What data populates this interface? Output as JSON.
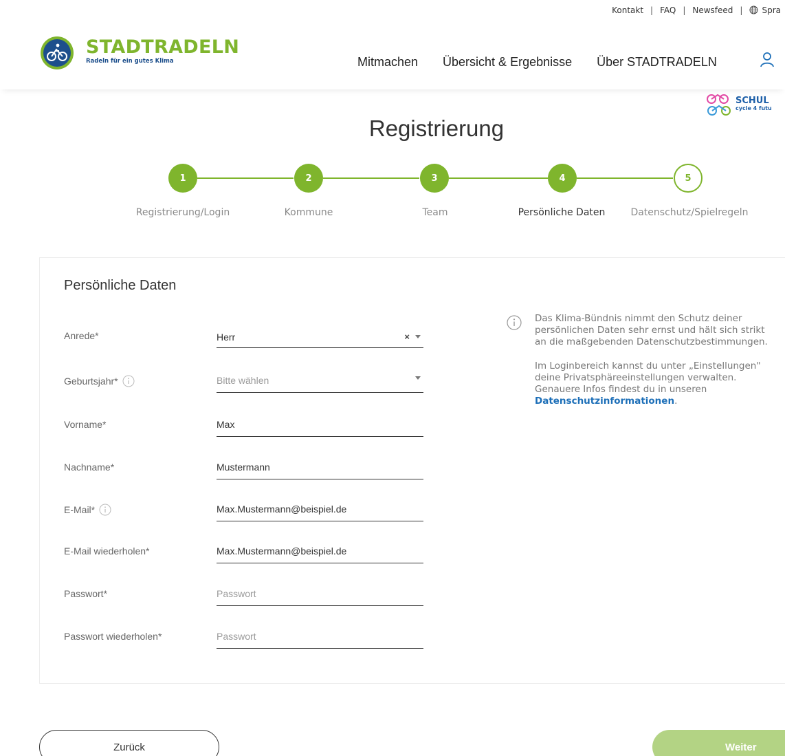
{
  "topbar": {
    "links": [
      "Kontakt",
      "FAQ",
      "Newsfeed"
    ],
    "language_label": "Spra"
  },
  "brand": {
    "name": "STADTRADELN",
    "tagline": "Radeln für ein gutes Klima"
  },
  "nav": {
    "items": [
      "Mitmachen",
      "Übersicht & Ergebnisse",
      "Über STADTRADELN"
    ]
  },
  "badge": {
    "title": "SCHUL",
    "subtitle": "cycle 4 futu"
  },
  "page": {
    "title": "Registrierung"
  },
  "stepper": {
    "steps": [
      {
        "number": "1",
        "label": "Registrierung/Login"
      },
      {
        "number": "2",
        "label": "Kommune"
      },
      {
        "number": "3",
        "label": "Team"
      },
      {
        "number": "4",
        "label": "Persönliche Daten"
      },
      {
        "number": "5",
        "label": "Datenschutz/Spielregeln"
      }
    ],
    "current_step": 4
  },
  "form": {
    "title": "Persönliche Daten",
    "fields": [
      {
        "label": "Anrede*",
        "value": "Herr",
        "placeholder": ""
      },
      {
        "label": "Geburtsjahr*",
        "value": "",
        "placeholder": "Bitte wählen"
      },
      {
        "label": "Vorname*",
        "value": "Max",
        "placeholder": ""
      },
      {
        "label": "Nachname*",
        "value": "Mustermann",
        "placeholder": ""
      },
      {
        "label": "E-Mail*",
        "value": "Max.Mustermann@beispiel.de",
        "placeholder": ""
      },
      {
        "label": "E-Mail wiederholen*",
        "value": "Max.Mustermann@beispiel.de",
        "placeholder": ""
      },
      {
        "label": "Passwort*",
        "value": "",
        "placeholder": "Passwort"
      },
      {
        "label": "Passwort wiederholen*",
        "value": "",
        "placeholder": "Passwort"
      }
    ],
    "clear_symbol": "×"
  },
  "info": {
    "paragraph1": "Das Klima-Bündnis nimmt den Schutz deiner persönlichen Daten sehr ernst und hält sich strikt an die maßgebenden Datenschutzbestimmungen.",
    "paragraph2": "Im Loginbereich kannst du unter „Einstellungen\" deine Privatsphäreeinstellungen verwalten. Genauere Infos findest du in unseren",
    "link": "Datenschutzinformationen",
    "trailing": "."
  },
  "buttons": {
    "back": "Zurück",
    "next": "Weiter"
  },
  "colors": {
    "brand_green": "#7fb52d",
    "brand_blue": "#1d4f8c",
    "link_blue": "#1d6fb8",
    "next_button": "#b3d384"
  }
}
